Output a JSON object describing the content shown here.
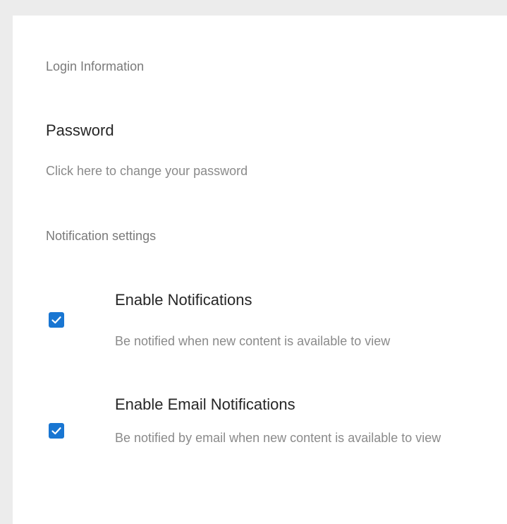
{
  "login_section": {
    "header": "Login Information",
    "password": {
      "title": "Password",
      "subtitle": "Click here to change your password"
    }
  },
  "notification_section": {
    "header": "Notification settings",
    "items": [
      {
        "title": "Enable Notifications",
        "subtitle": "Be notified when new content is available to view",
        "checked": true
      },
      {
        "title": "Enable Email Notifications",
        "subtitle": "Be notified by email when new content is available to view",
        "checked": true
      }
    ]
  },
  "colors": {
    "accent": "#1976d2",
    "background": "#ececec",
    "panel": "#ffffff"
  },
  "icons": [
    "checkmark-icon"
  ]
}
